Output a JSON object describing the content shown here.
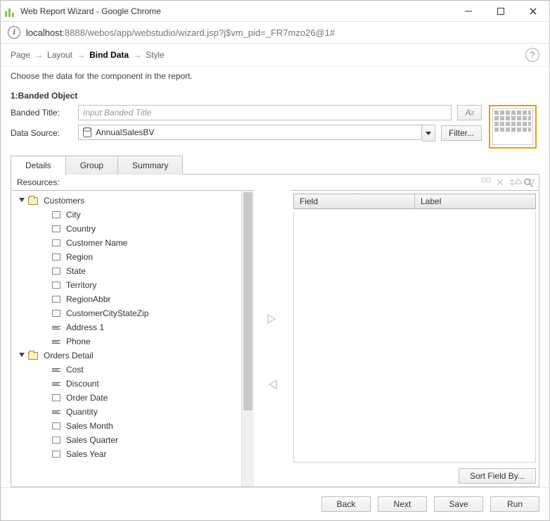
{
  "window": {
    "title": "Web Report Wizard - Google Chrome"
  },
  "url": {
    "host": "localhost",
    "rest": ":8888/webos/app/webstudio/wizard.jsp?j$vm_pid=_FR7mzo26@1#"
  },
  "breadcrumbs": {
    "steps": [
      "Page",
      "Layout",
      "Bind Data",
      "Style"
    ],
    "active_index": 2
  },
  "prompt": "Choose the data for the component in the report.",
  "section_title": "1:Banded Object",
  "form": {
    "banded_title_label": "Banded Title:",
    "banded_title_placeholder": "Input Banded Title",
    "banded_title_value": "",
    "data_source_label": "Data Source:",
    "data_source_value": "AnnualSalesBV",
    "filter_label": "Filter..."
  },
  "tabs": {
    "items": [
      "Details",
      "Group",
      "Summary"
    ],
    "active_index": 0
  },
  "left_pane": {
    "label": "Resources:",
    "tree": [
      {
        "type": "folder",
        "label": "Customers",
        "expandable": true,
        "expanded": true,
        "depth": 0
      },
      {
        "type": "field",
        "label": "City",
        "depth": 1
      },
      {
        "type": "field",
        "label": "Country",
        "depth": 1
      },
      {
        "type": "field",
        "label": "Customer Name",
        "depth": 1
      },
      {
        "type": "field",
        "label": "Region",
        "depth": 1
      },
      {
        "type": "field",
        "label": "State",
        "depth": 1
      },
      {
        "type": "field",
        "label": "Territory",
        "depth": 1
      },
      {
        "type": "field",
        "label": "RegionAbbr",
        "depth": 1
      },
      {
        "type": "field",
        "label": "CustomerCityStateZip",
        "depth": 1
      },
      {
        "type": "formula",
        "label": "Address 1",
        "depth": 1
      },
      {
        "type": "formula",
        "label": "Phone",
        "depth": 1
      },
      {
        "type": "folder",
        "label": "Orders Detail",
        "expandable": true,
        "expanded": true,
        "depth": 0
      },
      {
        "type": "formula",
        "label": "Cost",
        "depth": 1
      },
      {
        "type": "formula",
        "label": "Discount",
        "depth": 1
      },
      {
        "type": "field",
        "label": "Order Date",
        "depth": 1
      },
      {
        "type": "formula",
        "label": "Quantity",
        "depth": 1
      },
      {
        "type": "field",
        "label": "Sales Month",
        "depth": 1
      },
      {
        "type": "field",
        "label": "Sales Quarter",
        "depth": 1
      },
      {
        "type": "field",
        "label": "Sales Year",
        "depth": 1
      }
    ]
  },
  "right_pane": {
    "columns": [
      "Field",
      "Label"
    ],
    "sort_button": "Sort Field By..."
  },
  "footer": {
    "back": "Back",
    "next": "Next",
    "save": "Save",
    "run": "Run"
  }
}
